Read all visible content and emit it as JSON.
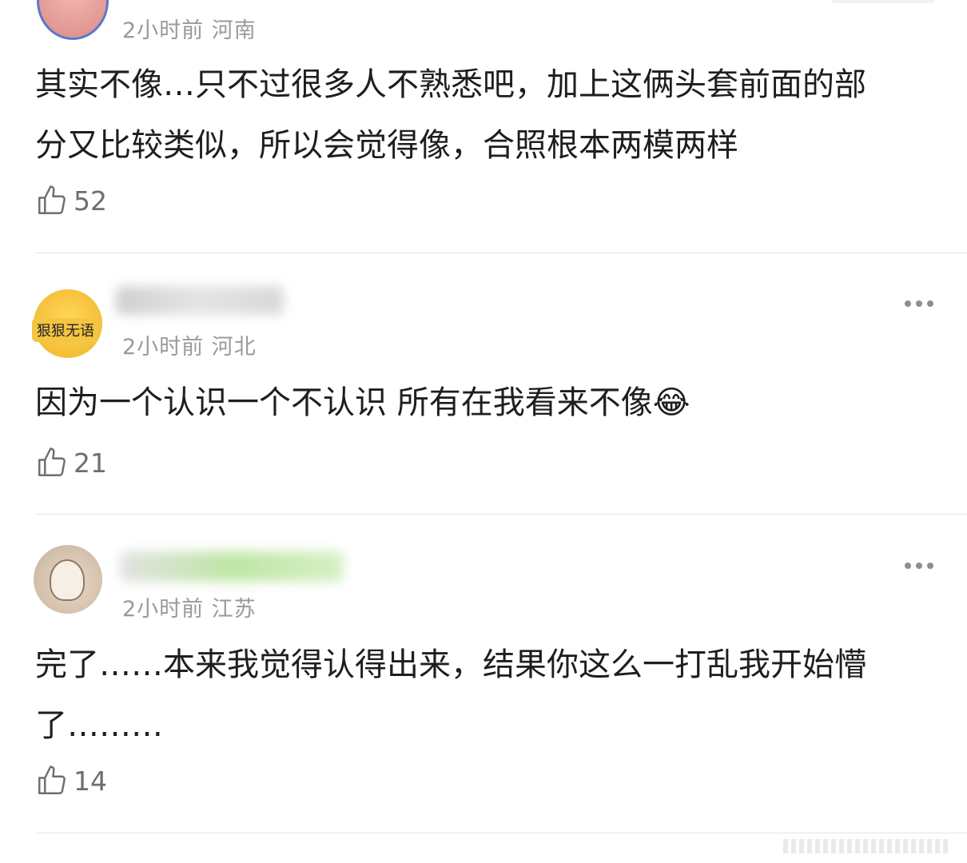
{
  "comments": [
    {
      "meta": "2小时前 河南",
      "text_lines": [
        "其实不像…只不过很多人不熟悉吧，加上这俩头套前面的部",
        "分又比较类似，所以会觉得像，合照根本两模两样"
      ],
      "likes": "52"
    },
    {
      "meta": "2小时前 河北",
      "avatar_badge": "狠狠无语",
      "text_lines": [
        "因为一个认识一个不认识 所有在我看来不像😂"
      ],
      "likes": "21"
    },
    {
      "meta": "2小时前 江苏",
      "text_lines": [
        "完了……本来我觉得认得出来，结果你这么一打乱我开始懵",
        "了………"
      ],
      "likes": "14"
    }
  ],
  "colors": {
    "meta": "#9a9a9a",
    "text": "#1e1e1e",
    "divider": "#e6e6e6",
    "badge_bg": "#f4c542"
  },
  "icons": {
    "like": "thumbs-up-icon",
    "more": "more-dots-icon"
  }
}
